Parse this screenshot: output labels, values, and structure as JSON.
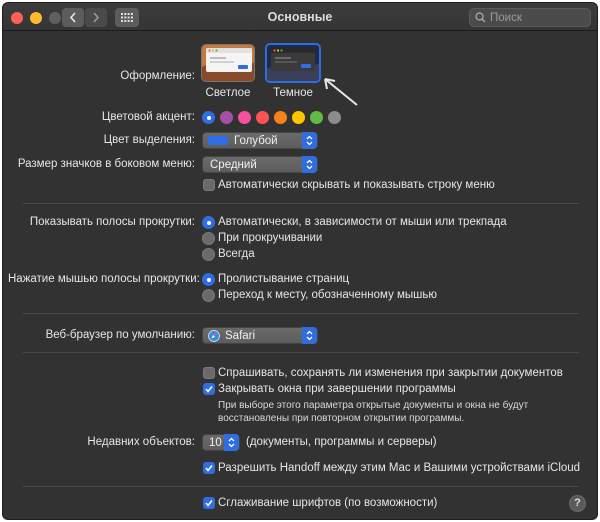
{
  "window": {
    "title": "Основные"
  },
  "search": {
    "placeholder": "Поиск"
  },
  "appearance": {
    "label": "Оформление:",
    "light": "Светлое",
    "dark": "Темное",
    "selected": "dark"
  },
  "accent": {
    "label": "Цветовой акцент:",
    "colors": [
      "#2f6de1",
      "#a550a7",
      "#f74f9e",
      "#ff5257",
      "#f7821b",
      "#ffc600",
      "#62ba46",
      "#8c8c8c"
    ],
    "selected_index": 0
  },
  "highlight": {
    "label": "Цвет выделения:",
    "value": "Голубой",
    "swatch": "#2f6de1"
  },
  "sidebar_icon_size": {
    "label": "Размер значков в боковом меню:",
    "value": "Средний"
  },
  "auto_hide_menubar": {
    "label": "Автоматически скрывать и показывать строку меню",
    "checked": false
  },
  "scrollbars": {
    "label": "Показывать полосы прокрутки:",
    "options": [
      "Автоматически, в зависимости от мыши или трекпада",
      "При прокручивании",
      "Всегда"
    ],
    "selected_index": 0
  },
  "scroll_click": {
    "label": "Нажатие мышью полосы прокрутки:",
    "options": [
      "Пролистывание страниц",
      "Переход к месту, обозначенному мышью"
    ],
    "selected_index": 0
  },
  "browser": {
    "label": "Веб-браузер по умолчанию:",
    "value": "Safari"
  },
  "ask_save": {
    "label": "Спрашивать, сохранять ли изменения при закрытии документов",
    "checked": false
  },
  "close_windows": {
    "label": "Закрывать окна при завершении программы",
    "checked": true,
    "note": "При выборе этого параметра открытые документы и окна не будут восстановлены при повторном открытии программы."
  },
  "recent": {
    "label": "Недавних объектов:",
    "value": "10",
    "suffix": "(документы, программы и серверы)"
  },
  "handoff": {
    "label": "Разрешить Handoff между этим Mac и Вашими устройствами iCloud",
    "checked": true
  },
  "font_smoothing": {
    "label": "Сглаживание шрифтов (по возможности)",
    "checked": true
  },
  "help": {
    "label": "?"
  }
}
